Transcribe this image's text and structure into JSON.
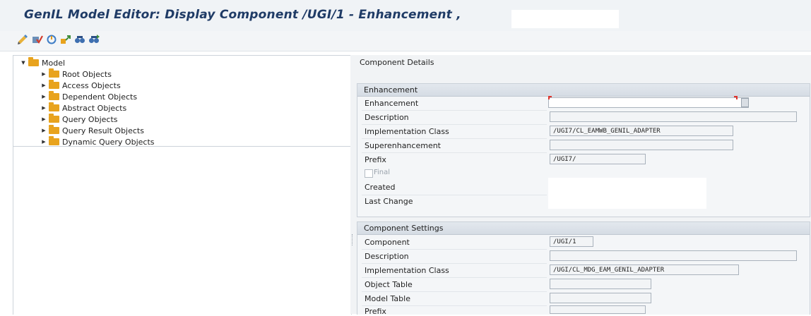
{
  "window": {
    "title": "GenIL Model Editor: Display Component  /UGI/1 - Enhancement ,"
  },
  "toolbar": {
    "icons": [
      "display-change-icon",
      "check-icon",
      "activate-icon",
      "where-used-icon",
      "find-icon",
      "find-next-icon"
    ]
  },
  "tree": {
    "root": "Model",
    "items": [
      {
        "label": "Root Objects"
      },
      {
        "label": "Access Objects"
      },
      {
        "label": "Dependent Objects"
      },
      {
        "label": "Abstract Objects"
      },
      {
        "label": "Query Objects"
      },
      {
        "label": "Query Result Objects"
      },
      {
        "label": "Dynamic Query Objects"
      }
    ]
  },
  "details": {
    "heading": "Component Details",
    "enhancement_group": {
      "title": "Enhancement",
      "enhancement_label": "Enhancement",
      "enhancement_value": "",
      "description_label": "Description",
      "description_value": "",
      "impl_class_label": "Implementation Class",
      "impl_class_value": "/UGI7/CL_EAMWB_GENIL_ADAPTER",
      "superenhancement_label": "Superenhancement",
      "superenhancement_value": "",
      "prefix_label": "Prefix",
      "prefix_value": "/UGI7/",
      "final_label": "Final",
      "final_checked": false,
      "created_label": "Created",
      "last_change_label": "Last Change"
    },
    "settings_group": {
      "title": "Component Settings",
      "component_label": "Component",
      "component_value": "/UGI/1",
      "description_label": "Description",
      "description_value": "",
      "impl_class_label": "Implementation Class",
      "impl_class_value": "/UGI/CL_MDG_EAM_GENIL_ADAPTER",
      "object_table_label": "Object Table",
      "object_table_value": "",
      "model_table_label": "Model Table",
      "model_table_value": "",
      "prefix_label": "Prefix",
      "prefix_value": ""
    }
  },
  "colors": {
    "title": "#1f3b66",
    "folder": "#e8a31e",
    "required_marker": "#e0322b"
  }
}
